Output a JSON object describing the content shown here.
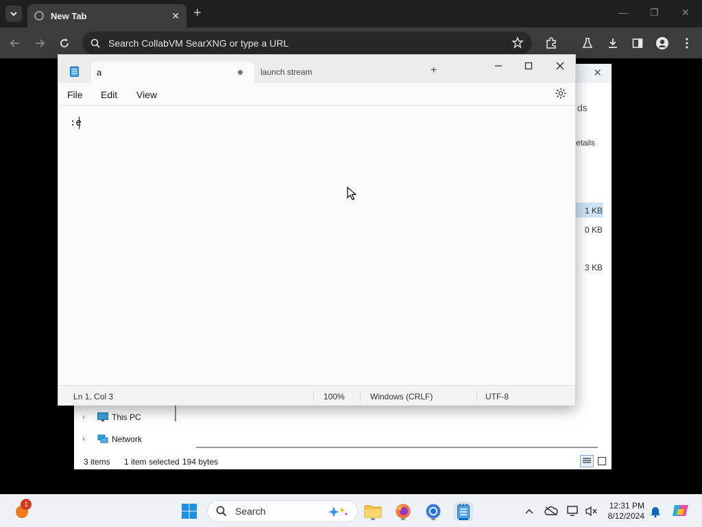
{
  "chrome": {
    "tab_title": "New Tab",
    "omnibox_placeholder": "Search CollabVM SearXNG or type a URL"
  },
  "explorer": {
    "right_fragments": [
      "ds",
      "etails",
      "1 KB",
      "0 KB",
      "3 KB"
    ],
    "sidebar": [
      {
        "label": "This PC",
        "icon": "monitor-icon"
      },
      {
        "label": "Network",
        "icon": "network-icon"
      }
    ],
    "status": {
      "items_count": "3 items",
      "selected": "1 item selected",
      "size": "194 bytes"
    }
  },
  "notepad": {
    "tabs": [
      {
        "label": "a",
        "active": true,
        "unsaved": true
      },
      {
        "label": "launch stream",
        "active": false
      }
    ],
    "menu": [
      "File",
      "Edit",
      "View"
    ],
    "content": ":e",
    "status": {
      "position": "Ln 1, Col 3",
      "zoom": "100%",
      "line_ending": "Windows (CRLF)",
      "encoding": "UTF-8"
    }
  },
  "taskbar": {
    "search_label": "Search",
    "widget_badge": "1",
    "time": "12:31 PM",
    "date": "8/12/2024",
    "accent": "#0a63c9"
  }
}
